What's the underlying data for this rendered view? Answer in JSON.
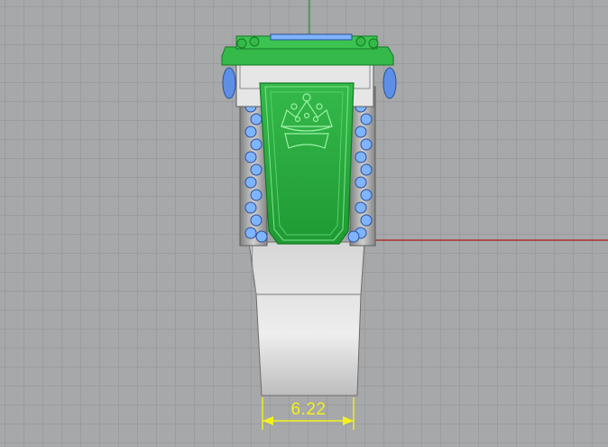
{
  "viewport": {
    "grid_color": "#9a9c9e",
    "background_color": "#a6a8aa",
    "x_axis_color": "#b01818",
    "y_axis_color": "#18a018"
  },
  "model": {
    "selected_color": "#25c23a",
    "metal_color": "#d9d9d9",
    "gem_color": "#7fb4ff"
  },
  "dimension": {
    "value": "6.22",
    "color": "#f2f21a"
  }
}
